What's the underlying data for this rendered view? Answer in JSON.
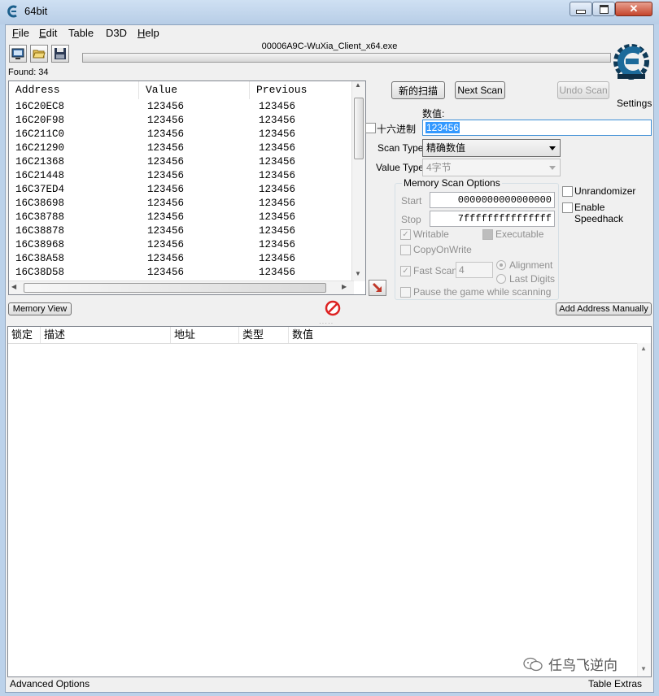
{
  "window": {
    "title": "64bit"
  },
  "menu": [
    {
      "accel": "F",
      "rest": "ile"
    },
    {
      "accel": "E",
      "rest": "dit"
    },
    {
      "accel": "",
      "rest": "Table"
    },
    {
      "accel": "",
      "rest": "D3D"
    },
    {
      "accel": "H",
      "rest": "elp"
    }
  ],
  "toolbar": {
    "icons": [
      "process-list-icon",
      "open-file-icon",
      "save-icon"
    ]
  },
  "process": {
    "name": "00006A9C-WuXia_Client_x64.exe"
  },
  "found": "Found: 34",
  "results": {
    "columns": [
      "Address",
      "Value",
      "Previous"
    ],
    "rows": [
      [
        "16C20EC8",
        "123456",
        "123456"
      ],
      [
        "16C20F98",
        "123456",
        "123456"
      ],
      [
        "16C211C0",
        "123456",
        "123456"
      ],
      [
        "16C21290",
        "123456",
        "123456"
      ],
      [
        "16C21368",
        "123456",
        "123456"
      ],
      [
        "16C21448",
        "123456",
        "123456"
      ],
      [
        "16C37ED4",
        "123456",
        "123456"
      ],
      [
        "16C38698",
        "123456",
        "123456"
      ],
      [
        "16C38788",
        "123456",
        "123456"
      ],
      [
        "16C38878",
        "123456",
        "123456"
      ],
      [
        "16C38968",
        "123456",
        "123456"
      ],
      [
        "16C38A58",
        "123456",
        "123456"
      ],
      [
        "16C38D58",
        "123456",
        "123456"
      ]
    ]
  },
  "scan": {
    "new_scan": "新的扫描",
    "next_scan": "Next Scan",
    "undo_scan": "Undo Scan",
    "settings": "Settings",
    "value_label": "数值:",
    "hex_label": "十六进制",
    "value": "123456",
    "scan_type_label": "Scan Type",
    "scan_type": "精确数值",
    "value_type_label": "Value Type",
    "value_type": "4字节"
  },
  "memory_options": {
    "title": "Memory Scan Options",
    "start_label": "Start",
    "start": "0000000000000000",
    "stop_label": "Stop",
    "stop": "7fffffffffffffff",
    "writable": "Writable",
    "executable": "Executable",
    "copy_on_write": "CopyOnWrite",
    "fast_scan": "Fast Scan",
    "fast_scan_value": "4",
    "alignment": "Alignment",
    "last_digits": "Last Digits",
    "pause": "Pause the game while scanning"
  },
  "extras": {
    "unrandomizer": "Unrandomizer",
    "speedhack": "Enable Speedhack"
  },
  "memory_view": "Memory View",
  "add_address": "Add Address Manually",
  "address_table": {
    "columns": [
      "锁定",
      "描述",
      "地址",
      "类型",
      "数值"
    ]
  },
  "status": {
    "advanced": "Advanced Options",
    "table_extras": "Table Extras",
    "watermark": "任鸟飞逆向"
  }
}
